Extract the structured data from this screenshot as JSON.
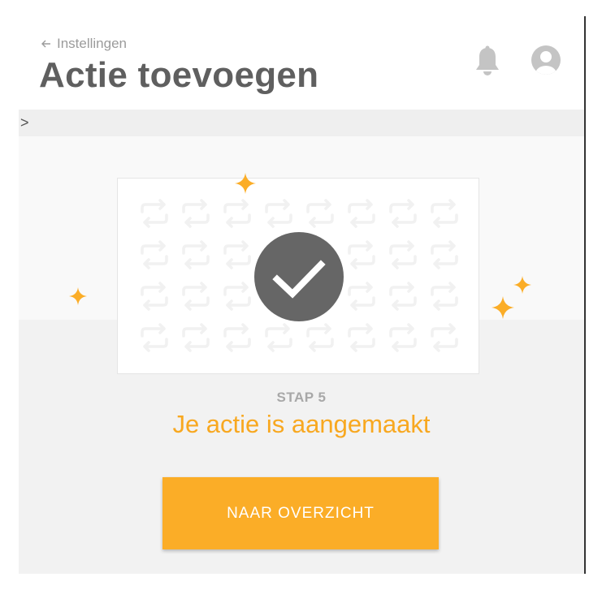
{
  "header": {
    "back_label": "Instellingen",
    "title": "Actie toevoegen"
  },
  "breadcrumb": {
    "separator": ">"
  },
  "confirmation": {
    "step_label": "STAP 5",
    "message": "Je actie is aangemaakt",
    "button_label": "NAAR OVERZICHT"
  },
  "icons": {
    "back": "arrow-left-icon",
    "notifications": "bell-icon",
    "account": "user-avatar-icon",
    "status": "checkmark-icon",
    "pattern": "repeat-icon",
    "decor": "sparkle-icon"
  },
  "colors": {
    "accent": "#fbad27",
    "accent_text": "#f8a820",
    "title": "#5f5f5f",
    "icon_gray": "#c4c4c4",
    "check_circle": "#666666",
    "pattern": "#f1f1f1"
  }
}
